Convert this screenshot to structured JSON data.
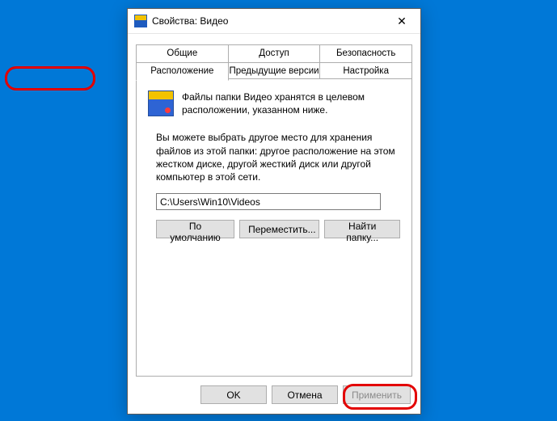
{
  "title": "Свойства: Видео",
  "tabs1": [
    "Общие",
    "Доступ",
    "Безопасность"
  ],
  "tabs2": [
    "Расположение",
    "Предыдущие версии",
    "Настройка"
  ],
  "info": "Файлы папки Видео хранятся в целевом расположении, указанном ниже.",
  "desc2": "Вы можете выбрать другое место для хранения файлов из этой папки: другое расположение на этом жестком диске, другой жесткий диск или другой компьютер в этой сети.",
  "path": "C:\\Users\\Win10\\Videos",
  "btn_default": "По умолчанию",
  "btn_move": "Переместить...",
  "btn_find": "Найти папку...",
  "btn_ok": "OK",
  "btn_cancel": "Отмена",
  "btn_apply": "Применить"
}
